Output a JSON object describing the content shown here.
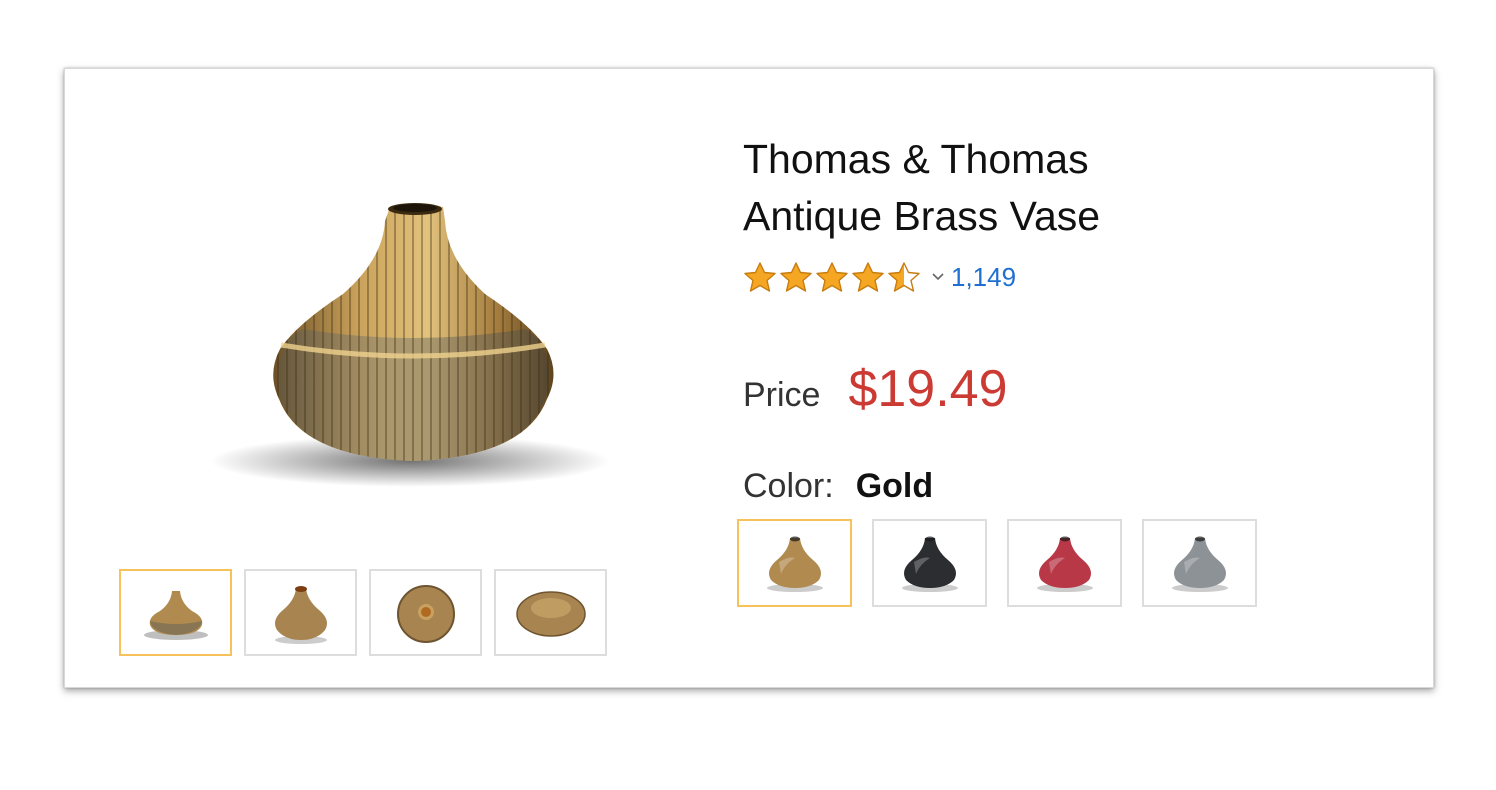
{
  "product": {
    "title_line1": "Thomas & Thomas",
    "title_line2": "Antique Brass Vase",
    "rating": 4.5,
    "rating_max": 5,
    "review_count": "1,149",
    "price_label": "Price",
    "price": "$19.49",
    "color_label": "Color:",
    "color_value": "Gold"
  },
  "thumbnails": [
    {
      "icon": "vase-side-view-icon",
      "selected": true
    },
    {
      "icon": "vase-angled-view-icon",
      "selected": false
    },
    {
      "icon": "vase-top-view-icon",
      "selected": false
    },
    {
      "icon": "vase-bottom-view-icon",
      "selected": false
    }
  ],
  "swatches": [
    {
      "name": "gold",
      "color": "#b08a4e",
      "selected": true
    },
    {
      "name": "black",
      "color": "#2b2d30",
      "selected": false
    },
    {
      "name": "red",
      "color": "#b83848",
      "selected": false
    },
    {
      "name": "gray",
      "color": "#8d9296",
      "selected": false
    }
  ],
  "colors": {
    "accent_border": "#f7c25c",
    "price": "#cc3a34",
    "link": "#1f6fd1",
    "star": "#f5a623"
  }
}
